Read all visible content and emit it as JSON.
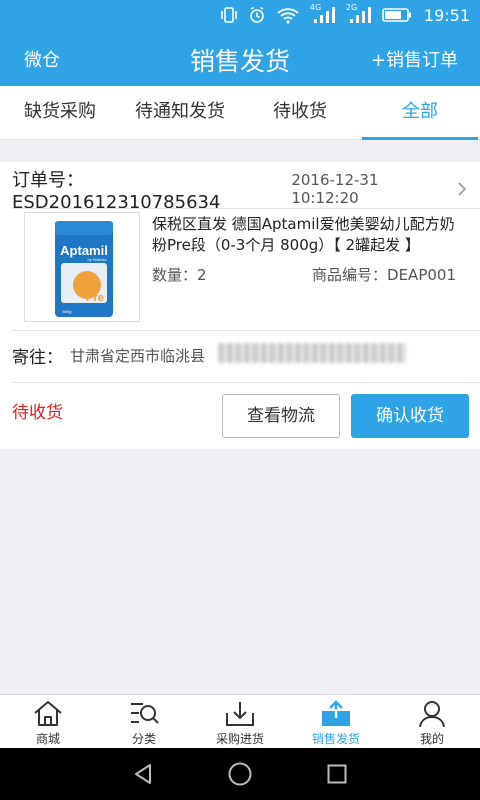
{
  "status_bar": {
    "time": "19:51",
    "icons": [
      "vibrate-icon",
      "alarm-icon",
      "wifi-icon",
      "signal-icon",
      "battery-icon"
    ],
    "network_4g": "4G",
    "network_2g": "2G"
  },
  "header": {
    "left_label": "微仓",
    "title": "销售发货",
    "right_label": "+销售订单",
    "color": "#2ea3e6"
  },
  "tabs": [
    {
      "label": "缺货采购",
      "active": false
    },
    {
      "label": "待通知发货",
      "active": false
    },
    {
      "label": "待收货",
      "active": false
    },
    {
      "label": "全部",
      "active": true
    }
  ],
  "order": {
    "order_no": "订单号：ESD201612310785634",
    "order_time": "2016-12-31 10:12:20",
    "product": {
      "name": "保税区直发 德国Aptamil爱他美婴幼儿配方奶粉Pre段（0-3个月 800g）【 2罐起发 】",
      "quantity": "数量：2",
      "sku": "商品编号：DEAP001",
      "image_brand": "Aptamil",
      "image_sub": "by Nutricia",
      "image_stage": "Pre",
      "image_weight": "800g"
    },
    "ship_label": "寄往：",
    "ship_address": "甘肃省定西市临洮县",
    "status": "待收货",
    "status_color": "#e02020",
    "btn_logistics": "查看物流",
    "btn_confirm": "确认收货"
  },
  "bottom_nav": [
    {
      "label": "商城",
      "icon": "home-icon",
      "active": false
    },
    {
      "label": "分类",
      "icon": "category-search-icon",
      "active": false
    },
    {
      "label": "采购进货",
      "icon": "download-tray-icon",
      "active": false
    },
    {
      "label": "销售发货",
      "icon": "upload-tray-icon",
      "active": true
    },
    {
      "label": "我的",
      "icon": "user-icon",
      "active": false
    }
  ],
  "system_nav": [
    "back-icon",
    "home-circle-icon",
    "recent-apps-icon"
  ]
}
